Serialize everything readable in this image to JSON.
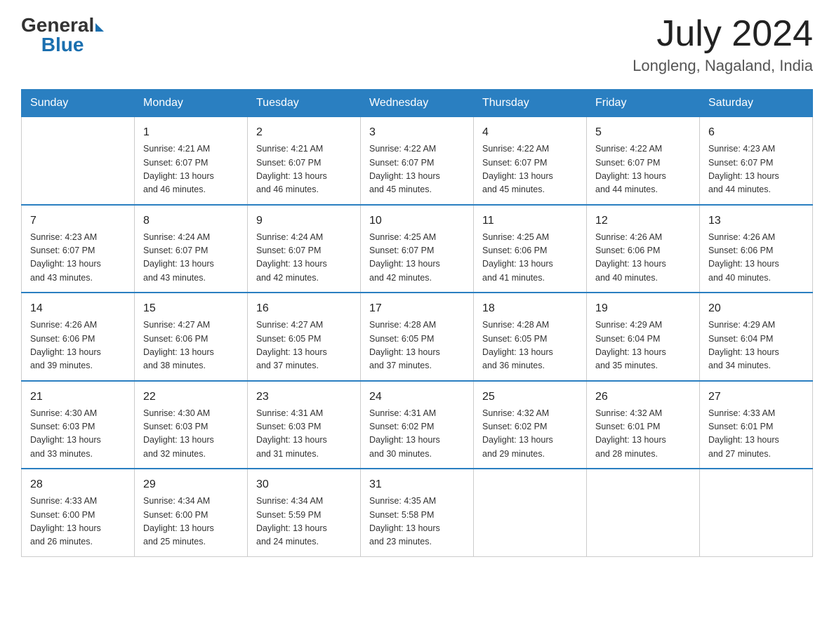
{
  "header": {
    "logo_general": "General",
    "logo_blue": "Blue",
    "month_year": "July 2024",
    "location": "Longleng, Nagaland, India"
  },
  "days_of_week": [
    "Sunday",
    "Monday",
    "Tuesday",
    "Wednesday",
    "Thursday",
    "Friday",
    "Saturday"
  ],
  "weeks": [
    [
      {
        "day": "",
        "info": ""
      },
      {
        "day": "1",
        "info": "Sunrise: 4:21 AM\nSunset: 6:07 PM\nDaylight: 13 hours\nand 46 minutes."
      },
      {
        "day": "2",
        "info": "Sunrise: 4:21 AM\nSunset: 6:07 PM\nDaylight: 13 hours\nand 46 minutes."
      },
      {
        "day": "3",
        "info": "Sunrise: 4:22 AM\nSunset: 6:07 PM\nDaylight: 13 hours\nand 45 minutes."
      },
      {
        "day": "4",
        "info": "Sunrise: 4:22 AM\nSunset: 6:07 PM\nDaylight: 13 hours\nand 45 minutes."
      },
      {
        "day": "5",
        "info": "Sunrise: 4:22 AM\nSunset: 6:07 PM\nDaylight: 13 hours\nand 44 minutes."
      },
      {
        "day": "6",
        "info": "Sunrise: 4:23 AM\nSunset: 6:07 PM\nDaylight: 13 hours\nand 44 minutes."
      }
    ],
    [
      {
        "day": "7",
        "info": "Sunrise: 4:23 AM\nSunset: 6:07 PM\nDaylight: 13 hours\nand 43 minutes."
      },
      {
        "day": "8",
        "info": "Sunrise: 4:24 AM\nSunset: 6:07 PM\nDaylight: 13 hours\nand 43 minutes."
      },
      {
        "day": "9",
        "info": "Sunrise: 4:24 AM\nSunset: 6:07 PM\nDaylight: 13 hours\nand 42 minutes."
      },
      {
        "day": "10",
        "info": "Sunrise: 4:25 AM\nSunset: 6:07 PM\nDaylight: 13 hours\nand 42 minutes."
      },
      {
        "day": "11",
        "info": "Sunrise: 4:25 AM\nSunset: 6:06 PM\nDaylight: 13 hours\nand 41 minutes."
      },
      {
        "day": "12",
        "info": "Sunrise: 4:26 AM\nSunset: 6:06 PM\nDaylight: 13 hours\nand 40 minutes."
      },
      {
        "day": "13",
        "info": "Sunrise: 4:26 AM\nSunset: 6:06 PM\nDaylight: 13 hours\nand 40 minutes."
      }
    ],
    [
      {
        "day": "14",
        "info": "Sunrise: 4:26 AM\nSunset: 6:06 PM\nDaylight: 13 hours\nand 39 minutes."
      },
      {
        "day": "15",
        "info": "Sunrise: 4:27 AM\nSunset: 6:06 PM\nDaylight: 13 hours\nand 38 minutes."
      },
      {
        "day": "16",
        "info": "Sunrise: 4:27 AM\nSunset: 6:05 PM\nDaylight: 13 hours\nand 37 minutes."
      },
      {
        "day": "17",
        "info": "Sunrise: 4:28 AM\nSunset: 6:05 PM\nDaylight: 13 hours\nand 37 minutes."
      },
      {
        "day": "18",
        "info": "Sunrise: 4:28 AM\nSunset: 6:05 PM\nDaylight: 13 hours\nand 36 minutes."
      },
      {
        "day": "19",
        "info": "Sunrise: 4:29 AM\nSunset: 6:04 PM\nDaylight: 13 hours\nand 35 minutes."
      },
      {
        "day": "20",
        "info": "Sunrise: 4:29 AM\nSunset: 6:04 PM\nDaylight: 13 hours\nand 34 minutes."
      }
    ],
    [
      {
        "day": "21",
        "info": "Sunrise: 4:30 AM\nSunset: 6:03 PM\nDaylight: 13 hours\nand 33 minutes."
      },
      {
        "day": "22",
        "info": "Sunrise: 4:30 AM\nSunset: 6:03 PM\nDaylight: 13 hours\nand 32 minutes."
      },
      {
        "day": "23",
        "info": "Sunrise: 4:31 AM\nSunset: 6:03 PM\nDaylight: 13 hours\nand 31 minutes."
      },
      {
        "day": "24",
        "info": "Sunrise: 4:31 AM\nSunset: 6:02 PM\nDaylight: 13 hours\nand 30 minutes."
      },
      {
        "day": "25",
        "info": "Sunrise: 4:32 AM\nSunset: 6:02 PM\nDaylight: 13 hours\nand 29 minutes."
      },
      {
        "day": "26",
        "info": "Sunrise: 4:32 AM\nSunset: 6:01 PM\nDaylight: 13 hours\nand 28 minutes."
      },
      {
        "day": "27",
        "info": "Sunrise: 4:33 AM\nSunset: 6:01 PM\nDaylight: 13 hours\nand 27 minutes."
      }
    ],
    [
      {
        "day": "28",
        "info": "Sunrise: 4:33 AM\nSunset: 6:00 PM\nDaylight: 13 hours\nand 26 minutes."
      },
      {
        "day": "29",
        "info": "Sunrise: 4:34 AM\nSunset: 6:00 PM\nDaylight: 13 hours\nand 25 minutes."
      },
      {
        "day": "30",
        "info": "Sunrise: 4:34 AM\nSunset: 5:59 PM\nDaylight: 13 hours\nand 24 minutes."
      },
      {
        "day": "31",
        "info": "Sunrise: 4:35 AM\nSunset: 5:58 PM\nDaylight: 13 hours\nand 23 minutes."
      },
      {
        "day": "",
        "info": ""
      },
      {
        "day": "",
        "info": ""
      },
      {
        "day": "",
        "info": ""
      }
    ]
  ]
}
